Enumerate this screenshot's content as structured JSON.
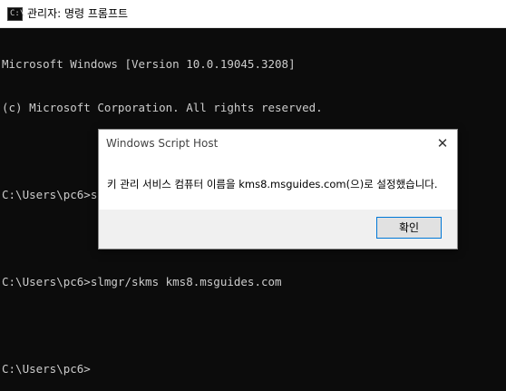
{
  "window": {
    "title": "관리자: 명령 프롬프트",
    "icon": "cmd-icon",
    "icon_prompt": "C:\\"
  },
  "console": {
    "lines": [
      "Microsoft Windows [Version 10.0.19045.3208]",
      "(c) Microsoft Corporation. All rights reserved.",
      "C:\\Users\\pc6>slmgr/ipk",
      "C:\\Users\\pc6>slmgr/skms kms8.msguides.com",
      "C:\\Users\\pc6>"
    ]
  },
  "dialog": {
    "title": "Windows Script Host",
    "message": "키 관리 서비스 컴퓨터 이름을 kms8.msguides.com(으)로 설정했습니다.",
    "ok_label": "확인",
    "close_glyph": "✕"
  },
  "colors": {
    "console_bg": "#0c0c0c",
    "console_text": "#cccccc",
    "accent": "#0078d7"
  }
}
